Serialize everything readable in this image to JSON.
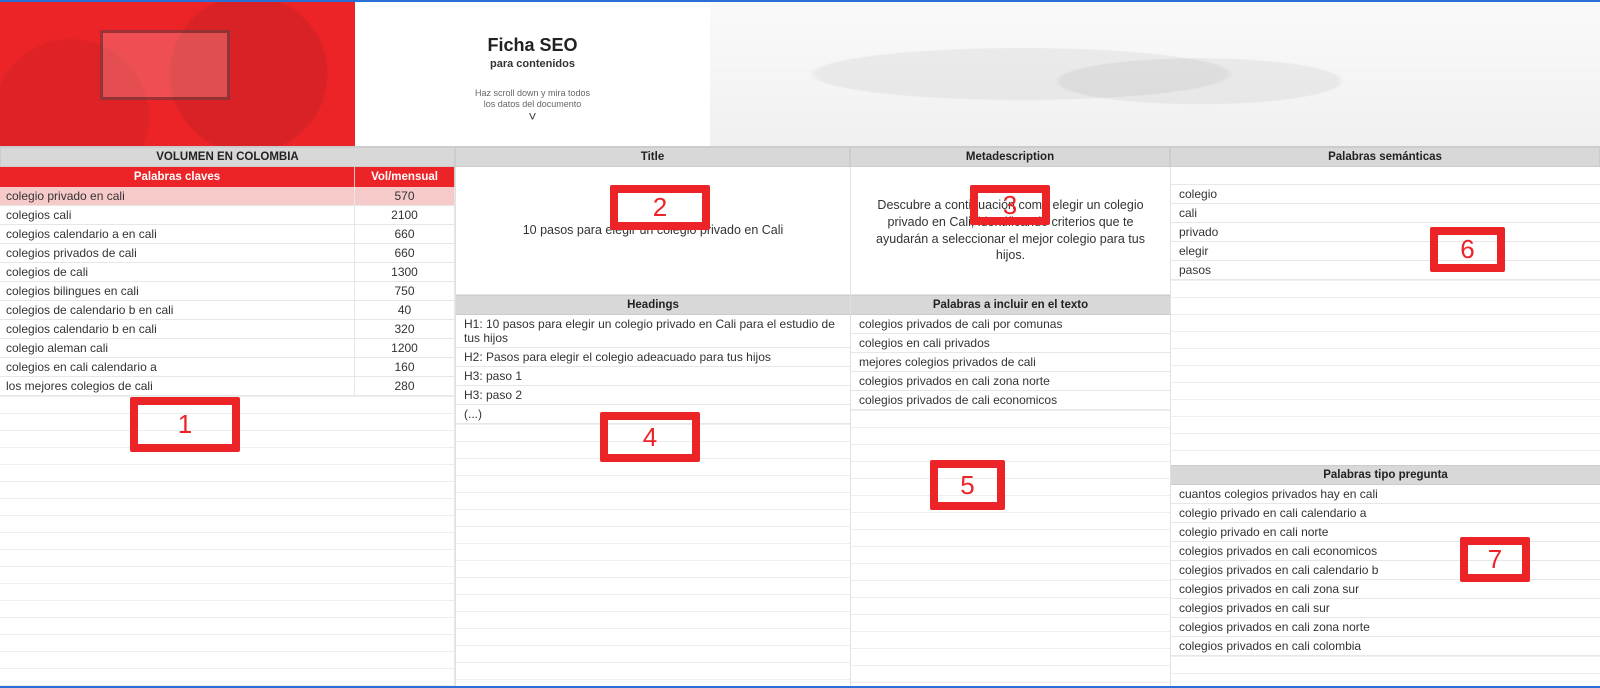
{
  "hero": {
    "title": "Ficha SEO",
    "subtitle": "para contenidos",
    "hint_line1": "Haz scroll down y mira todos",
    "hint_line2": "los datos del documento"
  },
  "headers": {
    "col1": "VOLUMEN EN COLOMBIA",
    "col2": "Title",
    "col3": "Metadescription",
    "col4": "Palabras semánticas",
    "kw_h1": "Palabras claves",
    "kw_h2": "Vol/mensual",
    "headings": "Headings",
    "include": "Palabras a incluir en el texto",
    "questions": "Palabras tipo pregunta"
  },
  "keywords": [
    {
      "kw": "colegio privado en cali",
      "vol": "570",
      "highlight": true
    },
    {
      "kw": "colegios cali",
      "vol": "2100"
    },
    {
      "kw": "colegios calendario a en cali",
      "vol": "660"
    },
    {
      "kw": "colegios privados de cali",
      "vol": "660"
    },
    {
      "kw": "colegios de cali",
      "vol": "1300"
    },
    {
      "kw": "colegios bilingues en cali",
      "vol": "750"
    },
    {
      "kw": "colegios de calendario b en cali",
      "vol": "40"
    },
    {
      "kw": "colegios calendario b en cali",
      "vol": "320"
    },
    {
      "kw": "colegio aleman cali",
      "vol": "1200"
    },
    {
      "kw": "colegios en cali calendario a",
      "vol": "160"
    },
    {
      "kw": "los mejores colegios de cali",
      "vol": "280"
    }
  ],
  "title_text": "10 pasos para elegir un colegio privado en Cali",
  "metadescription": "Descubre a continuación como elegir un colegio privado en Cali, identificando criterios que te ayudarán a seleccionar el mejor colegio para tus hijos.",
  "headings_list": [
    "H1: 10 pasos para elegir un colegio privado en Cali para el estudio de tus hijos",
    "H2: Pasos para elegir el colegio adeacuado para tus hijos",
    "H3: paso 1",
    "H3: paso 2",
    "(...)"
  ],
  "include_list": [
    "colegios privados de cali por comunas",
    "colegios en cali privados",
    "mejores colegios privados de cali",
    "colegios privados en cali zona norte",
    "colegios privados de cali economicos"
  ],
  "semantic_words": [
    "colegio",
    "cali",
    "privado",
    "elegir",
    "pasos"
  ],
  "question_words": [
    "cuantos colegios privados hay en cali",
    "colegio privado en cali calendario a",
    "colegio privado en cali norte",
    "colegios privados en cali economicos",
    "colegios privados en cali calendario b",
    "colegios privados en cali zona sur",
    "colegios privados en cali sur",
    "colegios privados en cali zona norte",
    "colegios privados en cali colombia"
  ],
  "callouts": {
    "c1": "1",
    "c2": "2",
    "c3": "3",
    "c4": "4",
    "c5": "5",
    "c6": "6",
    "c7": "7"
  }
}
